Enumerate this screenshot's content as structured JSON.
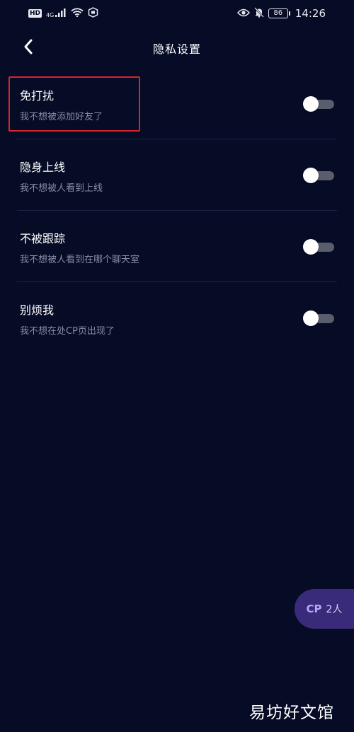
{
  "status_bar": {
    "hd": "HD",
    "network": "4G",
    "battery": "86",
    "time": "14:26"
  },
  "header": {
    "title": "隐私设置"
  },
  "settings": [
    {
      "title": "免打扰",
      "desc": "我不想被添加好友了",
      "enabled": false
    },
    {
      "title": "隐身上线",
      "desc": "我不想被人看到上线",
      "enabled": false
    },
    {
      "title": "不被跟踪",
      "desc": "我不想被人看到在哪个聊天室",
      "enabled": false
    },
    {
      "title": "别烦我",
      "desc": "我不想在处CP页出现了",
      "enabled": false
    }
  ],
  "cp_pill": {
    "label": "CP",
    "count": "2人"
  },
  "watermark": "易坊好文馆",
  "colors": {
    "background": "#060b26",
    "toggle_off_track": "#5a5d6b",
    "highlight": "#d8242e",
    "cp_pill": "#3a2a7a"
  }
}
